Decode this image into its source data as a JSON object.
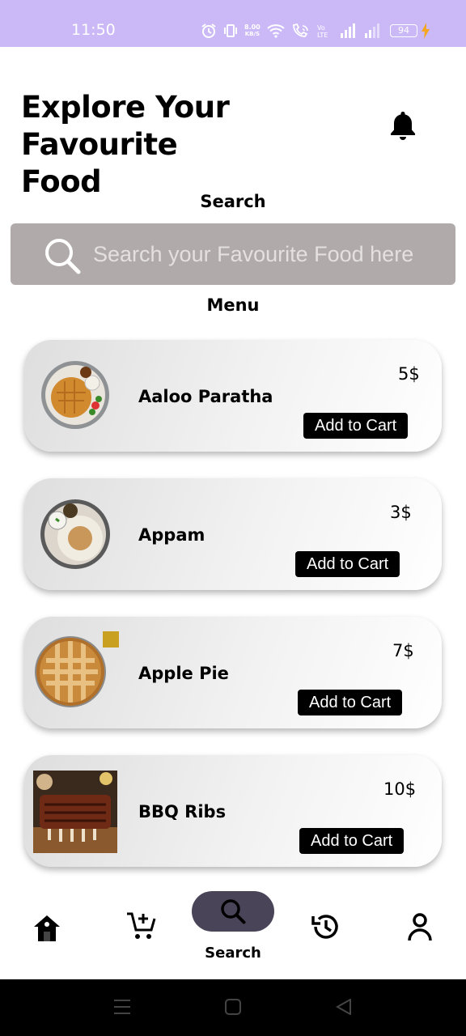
{
  "status_bar": {
    "time": "11:50",
    "net_speed_value": "8.00",
    "net_speed_unit": "KB/S",
    "battery": "94"
  },
  "header": {
    "title": "Explore Your Favourite\n Food"
  },
  "search": {
    "caption": "Search",
    "placeholder": "Search your Favourite Food here"
  },
  "menu": {
    "caption": "Menu",
    "items": [
      {
        "name": "Aaloo Paratha",
        "price": "5$",
        "button": "Add to Cart"
      },
      {
        "name": "Appam",
        "price": "3$",
        "button": "Add to Cart"
      },
      {
        "name": "Apple Pie",
        "price": "7$",
        "button": "Add to Cart"
      },
      {
        "name": "BBQ Ribs",
        "price": "10$",
        "button": "Add to Cart"
      }
    ]
  },
  "bottom_nav": {
    "items": [
      {
        "icon": "home-icon"
      },
      {
        "icon": "add-to-cart-icon"
      },
      {
        "icon": "search-icon",
        "label": "Search",
        "active": true
      },
      {
        "icon": "history-icon"
      },
      {
        "icon": "profile-icon"
      }
    ]
  },
  "colors": {
    "status_bar": "#cbb8f7",
    "search_box": "#b1aaaa",
    "nav_pill": "#4a4458",
    "button": "#000000"
  }
}
